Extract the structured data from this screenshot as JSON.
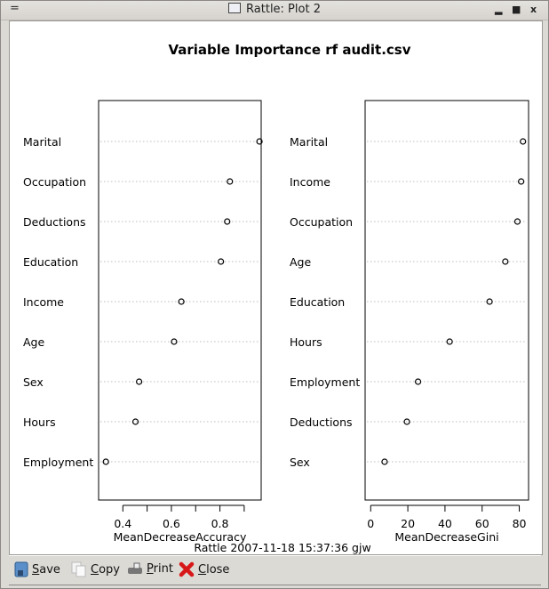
{
  "window": {
    "title": "Rattle: Plot 2",
    "menu_icon": "menu-icon",
    "controls": {
      "minimize": "▂",
      "maximize": "■",
      "close": "x"
    }
  },
  "toolbar": {
    "items": [
      {
        "key": "S",
        "rest": "ave",
        "icon": "save-icon"
      },
      {
        "key": "C",
        "rest": "opy",
        "icon": "copy-icon"
      },
      {
        "key": "P",
        "rest": "rint",
        "icon": "print-icon"
      },
      {
        "key": "C",
        "rest": "lose",
        "icon": "close-icon"
      }
    ]
  },
  "chart_data": {
    "title": "Variable Importance rf audit.csv",
    "footer": "Rattle 2007-11-18 15:37:36 gjw",
    "panels": [
      {
        "type": "scatter",
        "xlabel": "MeanDecreaseAccuracy",
        "xlim": [
          0.3,
          0.97
        ],
        "ticks": [
          0.4,
          0.5,
          0.6,
          0.7,
          0.8,
          0.9
        ],
        "tick_labels": [
          "0.4",
          "",
          "0.6",
          "",
          "0.8",
          ""
        ],
        "grid": "dotted-horizontal",
        "categories": [
          "Marital",
          "Occupation",
          "Deductions",
          "Education",
          "Income",
          "Age",
          "Sex",
          "Hours",
          "Employment"
        ],
        "values": [
          0.963,
          0.841,
          0.83,
          0.804,
          0.641,
          0.611,
          0.467,
          0.452,
          0.33
        ]
      },
      {
        "type": "scatter",
        "xlabel": "MeanDecreaseGini",
        "xlim": [
          -3,
          85
        ],
        "ticks": [
          0,
          20,
          40,
          60,
          80
        ],
        "tick_labels": [
          "0",
          "20",
          "40",
          "60",
          "80"
        ],
        "grid": "dotted-horizontal",
        "categories": [
          "Marital",
          "Income",
          "Occupation",
          "Age",
          "Education",
          "Hours",
          "Employment",
          "Deductions",
          "Sex"
        ],
        "values": [
          82,
          81,
          79,
          72.5,
          64,
          42.5,
          25.5,
          19.5,
          7.5
        ]
      }
    ]
  }
}
